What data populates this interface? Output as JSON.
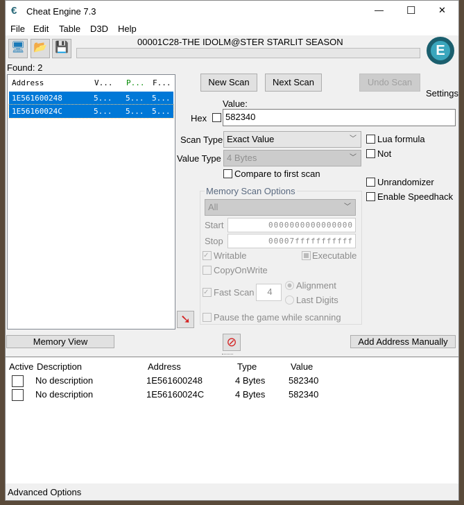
{
  "window": {
    "title": "Cheat Engine 7.3",
    "controls": {
      "minimize": "—",
      "maximize": "☐",
      "close": "✕"
    }
  },
  "menu": [
    "File",
    "Edit",
    "Table",
    "D3D",
    "Help"
  ],
  "process": "00001C28-THE IDOLM@STER STARLIT SEASON",
  "progress": 0,
  "found": "Found: 2",
  "results": {
    "headers": [
      "Address",
      "V...",
      "P...",
      "F..."
    ],
    "rows": [
      {
        "address": "1E561600248",
        "v": "5...",
        "p": "5...",
        "f": "5..."
      },
      {
        "address": "1E56160024C",
        "v": "5...",
        "p": "5...",
        "f": "5..."
      }
    ]
  },
  "buttons": {
    "new_scan": "New Scan",
    "next_scan": "Next Scan",
    "undo_scan": "Undo Scan",
    "settings": "Settings",
    "memory_view": "Memory View",
    "add_address": "Add Address Manually"
  },
  "value": {
    "label": "Value:",
    "hex_label": "Hex",
    "value": "582340"
  },
  "scan_type": {
    "label": "Scan Type",
    "value": "Exact Value"
  },
  "value_type": {
    "label": "Value Type",
    "value": "4 Bytes"
  },
  "compare_first": "Compare to first scan",
  "options": {
    "lua": "Lua formula",
    "not": "Not",
    "unrandomizer": "Unrandomizer",
    "speedhack": "Enable Speedhack"
  },
  "memory_scan": {
    "title": "Memory Scan Options",
    "region": "All",
    "start_label": "Start",
    "start": "0000000000000000",
    "stop_label": "Stop",
    "stop": "00007fffffffffff",
    "writable": "Writable",
    "executable": "Executable",
    "copyonwrite": "CopyOnWrite",
    "fast_scan": "Fast Scan",
    "fast_value": "4",
    "alignment": "Alignment",
    "last_digits": "Last Digits",
    "pause": "Pause the game while scanning"
  },
  "table": {
    "headers": [
      "Active",
      "Description",
      "Address",
      "Type",
      "Value"
    ],
    "rows": [
      {
        "description": "No description",
        "address": "1E561600248",
        "type": "4 Bytes",
        "value": "582340"
      },
      {
        "description": "No description",
        "address": "1E56160024C",
        "type": "4 Bytes",
        "value": "582340"
      }
    ]
  },
  "footer": {
    "advanced": "Advanced Options"
  }
}
